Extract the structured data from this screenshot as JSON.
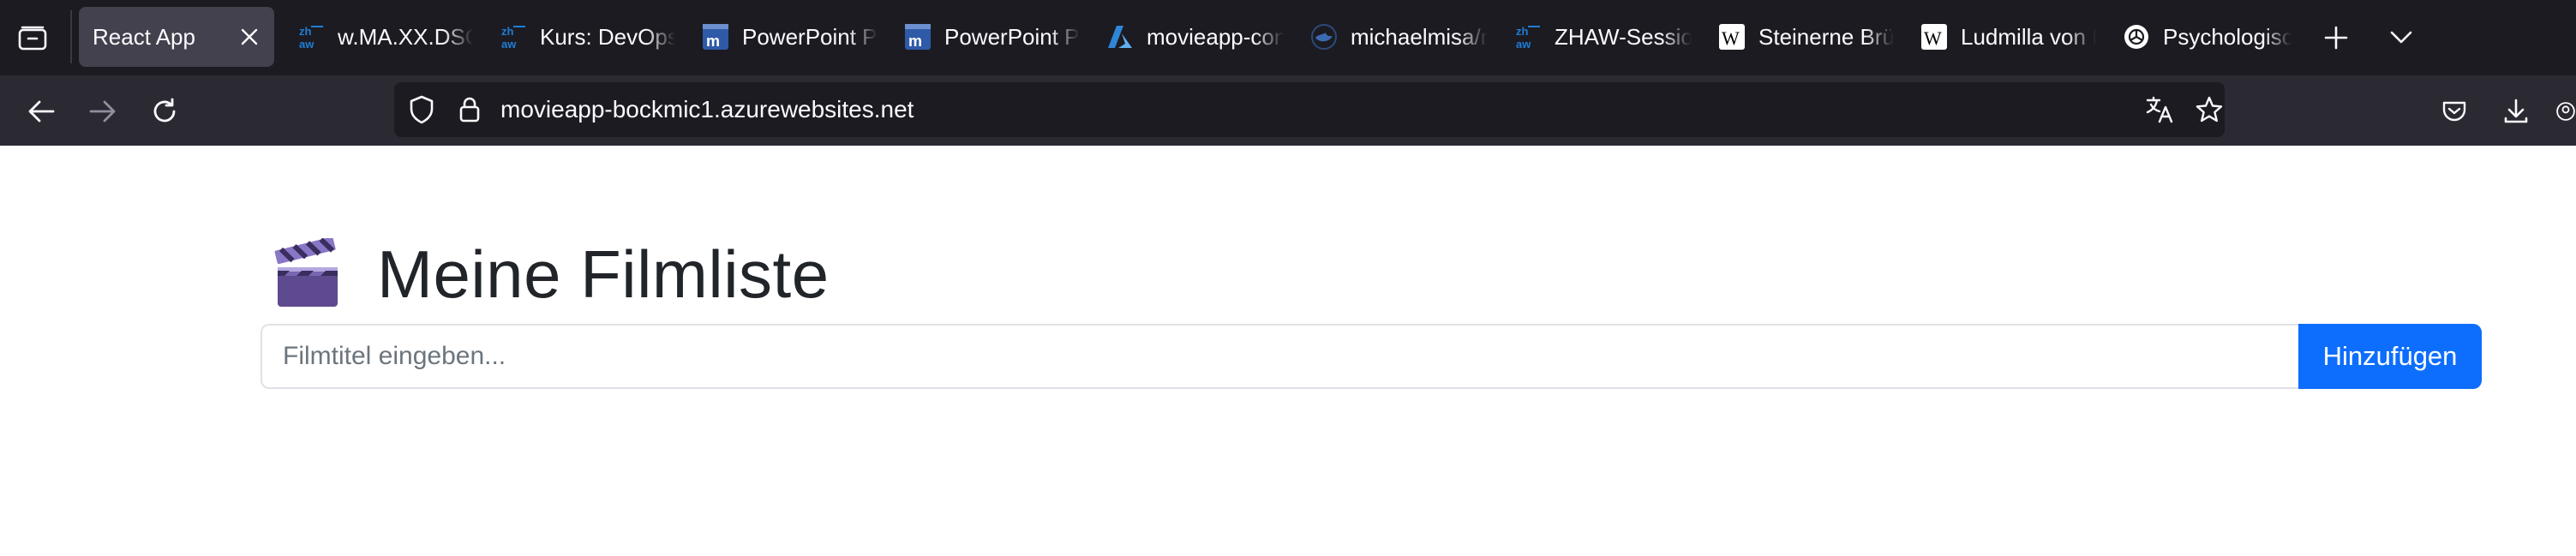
{
  "browser": {
    "tabs": [
      {
        "title": "React App",
        "icon": "none",
        "active": true
      },
      {
        "title": "w.MA.XX.DSOps",
        "icon": "zhaw-logo-icon",
        "active": false
      },
      {
        "title": "Kurs: DevOps",
        "icon": "zhaw-logo-icon",
        "active": false
      },
      {
        "title": "PowerPoint Präsentation",
        "icon": "moodle-icon",
        "active": false
      },
      {
        "title": "PowerPoint Präsentation",
        "icon": "moodle-icon",
        "active": false
      },
      {
        "title": "movieapp-container",
        "icon": "azure-icon",
        "active": false
      },
      {
        "title": "michaelmisa/movieapp",
        "icon": "docker-icon",
        "active": false
      },
      {
        "title": "ZHAW-Session",
        "icon": "zhaw-logo-icon",
        "active": false
      },
      {
        "title": "Steinerne Brücke",
        "icon": "wikipedia-icon",
        "active": false
      },
      {
        "title": "Ludmilla von Böhmen",
        "icon": "wikipedia-icon",
        "active": false
      },
      {
        "title": "Psychologische",
        "icon": "openai-icon",
        "active": false
      }
    ],
    "url": "movieapp-bockmic1.azurewebsites.net"
  },
  "page": {
    "title": "Meine Filmliste",
    "input": {
      "placeholder": "Filmtitel eingeben...",
      "value": ""
    },
    "add_button_label": "Hinzufügen"
  },
  "colors": {
    "tabbar_bg": "#1c1b22",
    "navbar_bg": "#2b2a33",
    "active_tab_bg": "#42414d",
    "primary_button": "#0d6efd",
    "title_text": "#212529"
  }
}
